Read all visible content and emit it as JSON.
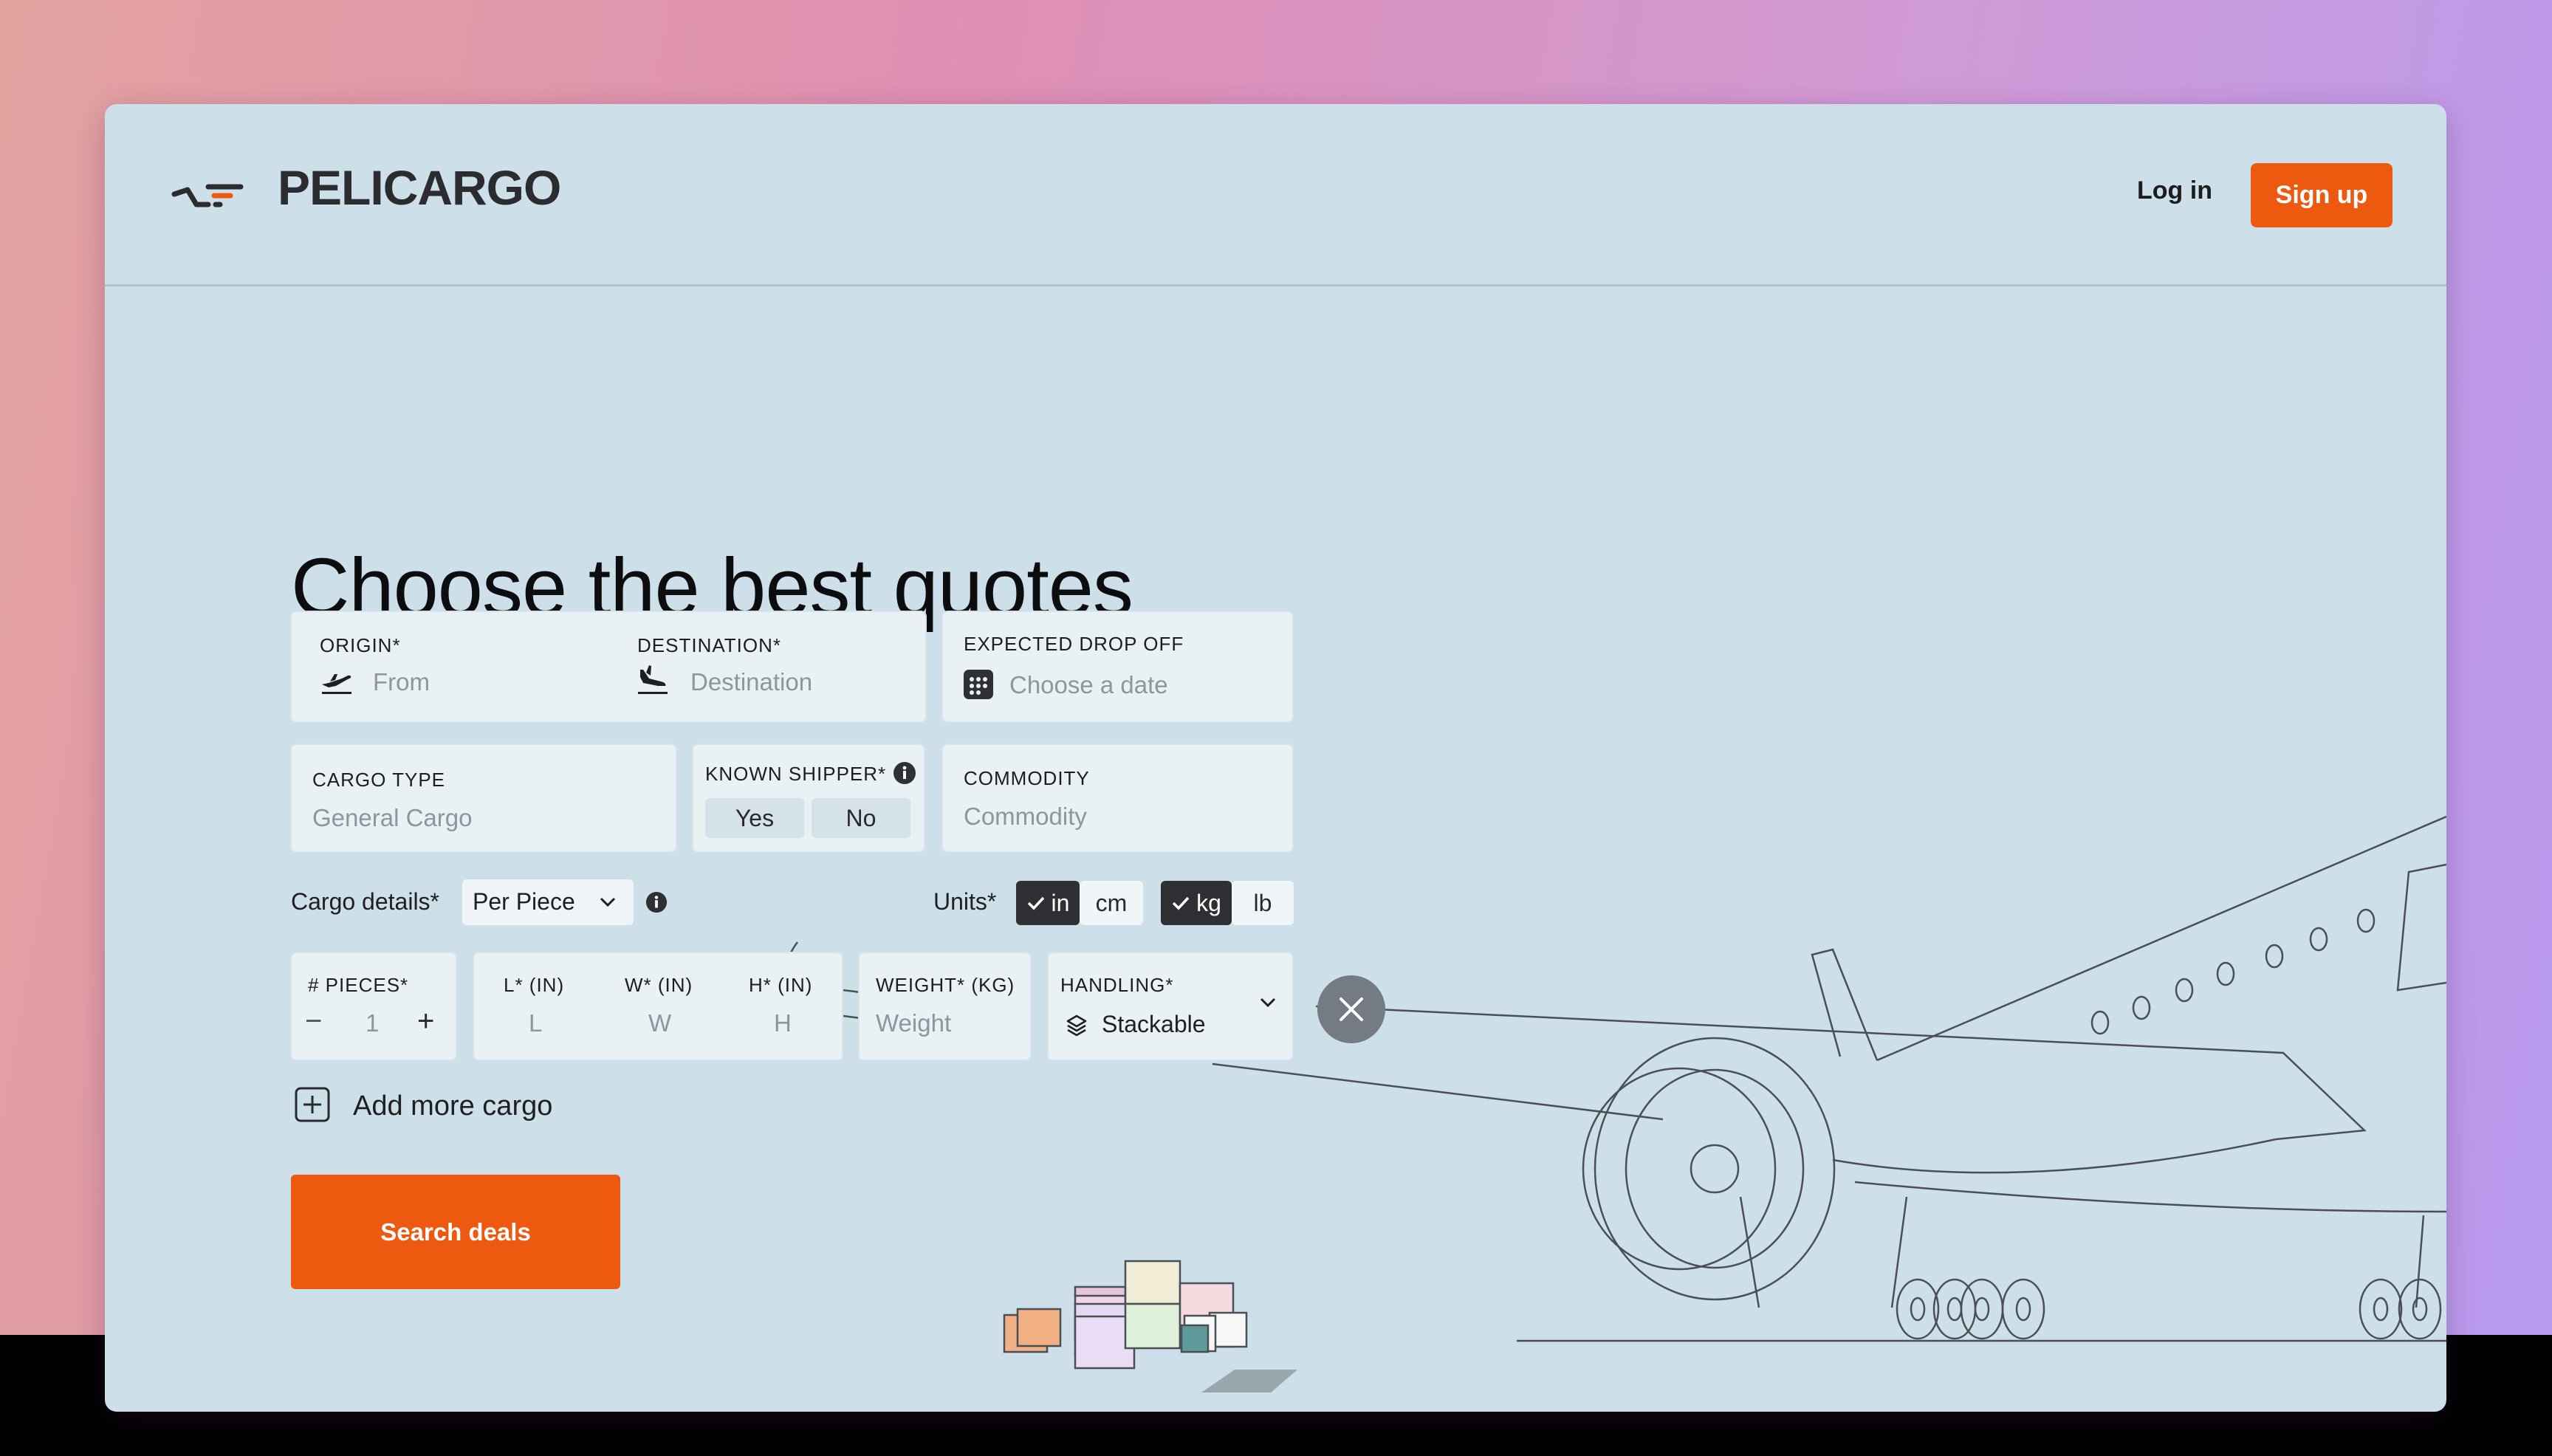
{
  "brand": {
    "name": "PELICARGO"
  },
  "header": {
    "login_label": "Log in",
    "signup_label": "Sign up"
  },
  "hero": {
    "title": "Choose the best quotes"
  },
  "route": {
    "origin_label": "ORIGIN*",
    "origin_placeholder": "From",
    "destination_label": "DESTINATION*",
    "destination_placeholder": "Destination"
  },
  "drop_off": {
    "label": "EXPECTED DROP OFF",
    "placeholder": "Choose a date"
  },
  "cargo_type": {
    "label": "CARGO TYPE",
    "placeholder": "General Cargo"
  },
  "known_shipper": {
    "label": "KNOWN SHIPPER*",
    "yes": "Yes",
    "no": "No"
  },
  "commodity": {
    "label": "COMMODITY",
    "placeholder": "Commodity"
  },
  "cargo_details": {
    "label": "Cargo details*",
    "mode": "Per Piece"
  },
  "units": {
    "label": "Units*",
    "length_options": [
      "in",
      "cm"
    ],
    "length_selected": "in",
    "weight_options": [
      "kg",
      "lb"
    ],
    "weight_selected": "kg"
  },
  "pieces": {
    "label": "# PIECES*",
    "value": "1",
    "minus": "−",
    "plus": "+"
  },
  "dimensions": {
    "l_label": "L* (IN)",
    "w_label": "W* (IN)",
    "h_label": "H* (IN)",
    "l_placeholder": "L",
    "w_placeholder": "W",
    "h_placeholder": "H"
  },
  "weight": {
    "label": "WEIGHT* (KG)",
    "placeholder": "Weight"
  },
  "handling": {
    "label": "HANDLING*",
    "value": "Stackable"
  },
  "add_more": {
    "label": "Add more cargo"
  },
  "search": {
    "label": "Search deals"
  },
  "colors": {
    "accent": "#ed5a0f",
    "window_bg": "#cddfe8",
    "card_bg": "#e9f1f5",
    "dark_chip": "#2f3034"
  },
  "icons": [
    "plane-takeoff-icon",
    "plane-landing-icon",
    "calendar-icon",
    "info-icon",
    "chevron-down-icon",
    "check-icon",
    "layers-icon",
    "plus-square-icon",
    "close-icon"
  ]
}
